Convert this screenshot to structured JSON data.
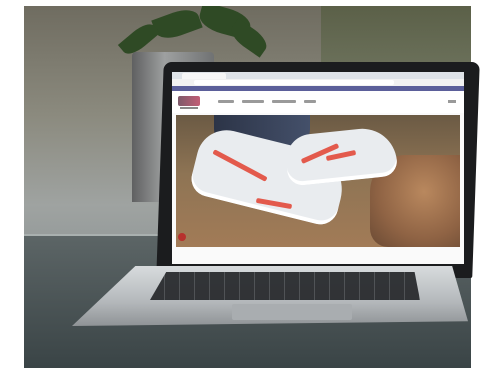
{
  "scene": {
    "description_colors": {
      "wall": "#8b8a7e",
      "table": "#3a4446",
      "laptop_bezel": "#1b1c1e",
      "screen_bg": "#fafafa",
      "accent_stripe": "#e35a4c",
      "bookmarks_bar": "#5b5f9a"
    }
  },
  "laptop_screen": {
    "site_logo_text": "",
    "hero_alt": ""
  }
}
